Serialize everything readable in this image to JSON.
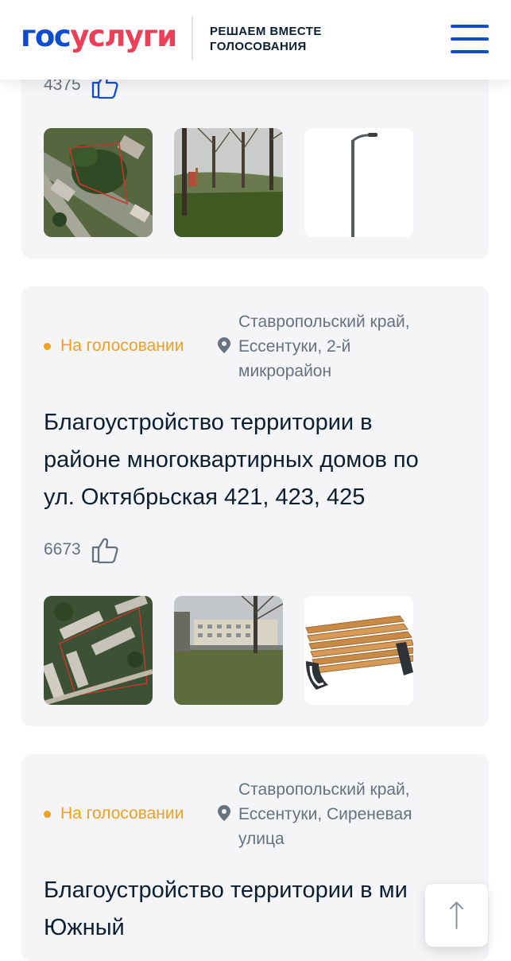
{
  "header": {
    "logo_part1": "гос",
    "logo_part2": "услуги",
    "tagline_line1": "РЕШАЕМ ВМЕСТЕ",
    "tagline_line2": "ГОЛОСОВАНИЯ",
    "menu_icon": "burger-menu-icon"
  },
  "colors": {
    "brand_blue": "#0d4cd3",
    "brand_red": "#ee3f58",
    "status_orange": "#f0a020",
    "card_bg": "#f5f5f7",
    "muted_text": "#66727f"
  },
  "cards": [
    {
      "likes": "4375",
      "images": [
        "aerial-map-photo",
        "park-trees-photo",
        "street-lamp-photo"
      ]
    },
    {
      "status": "На голосовании",
      "location_line1": "Ставропольский край,",
      "location_line2": "Ессентуки, 2-й",
      "location_line3": "микрорайон",
      "title_line1": "Благоустройство территории в",
      "title_line2": "районе многоквартирных домов по",
      "title_line3": "ул. Октябрьская 421, 423, 425",
      "likes": "6673",
      "images": [
        "aerial-map-photo",
        "courtyard-photo",
        "wooden-bench-photo"
      ]
    },
    {
      "status": "На голосовании",
      "location_line1": "Ставропольский край,",
      "location_line2": "Ессентуки, Сиреневая",
      "location_line3": "улица",
      "title_line1": "Благоустройство территории в ми",
      "title_line2": "Южный"
    }
  ],
  "scroll_top_icon": "arrow-up-icon"
}
